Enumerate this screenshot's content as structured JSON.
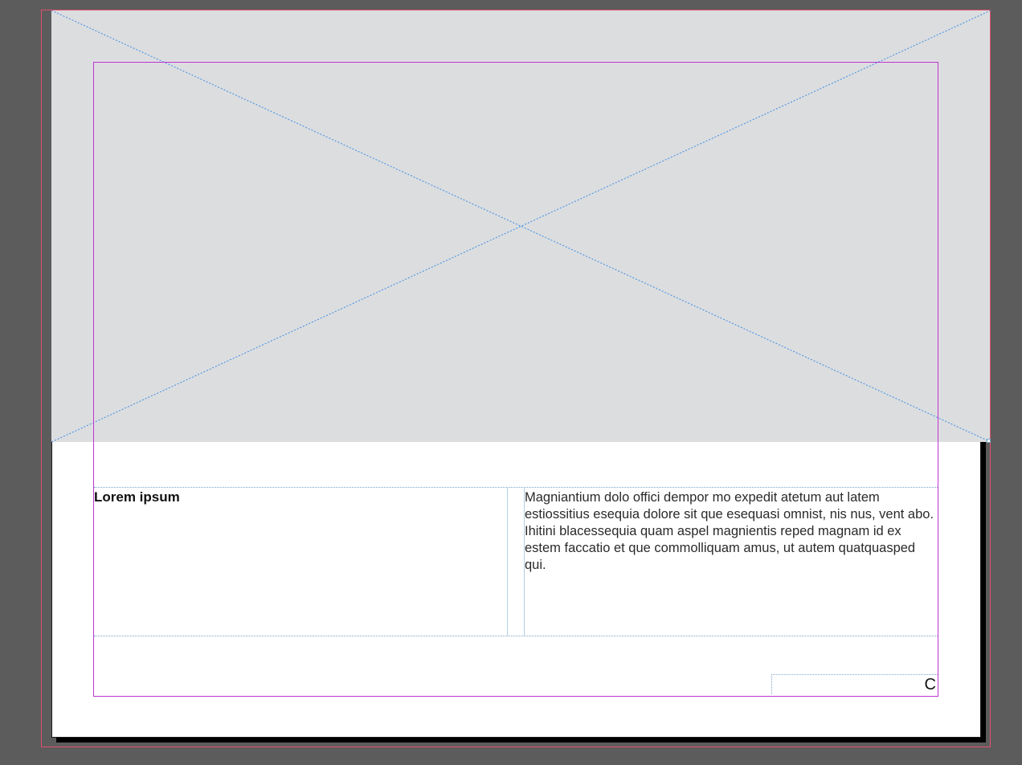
{
  "layout_document": {
    "image_placeholder": {
      "fill": "#dcdddf",
      "cross_color": "#3a8ee6"
    },
    "text_frame": {
      "heading": "Lorem ipsum",
      "body": "Magniantium dolo offici dempor mo expedit atetum aut latem estiossitius esequia dolore sit que esequasi omnist, nis nus, vent abo. Ihitini blacessequia quam aspel magnientis reped magnam id ex estem faccatio et que commolliquam amus, ut autem quatquasped qui."
    },
    "footer": {
      "marker": "C"
    },
    "colors": {
      "pasteboard": "#5c5c5c",
      "bleed_guide": "#e0506e",
      "margin_guide": "#c233d6",
      "frame_guide": "#7aa7c9"
    }
  }
}
